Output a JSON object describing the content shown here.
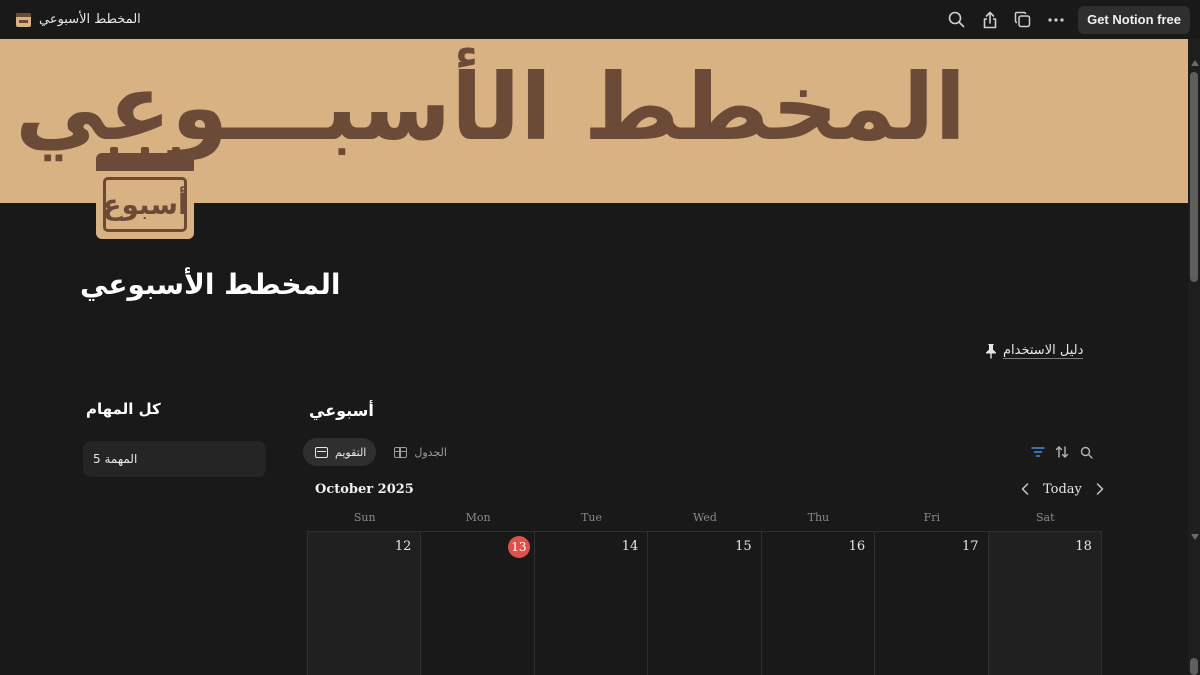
{
  "topbar": {
    "page_title": "المخطط الأسبوعي",
    "get_notion_label": "Get Notion free"
  },
  "cover": {
    "text": "المخطط الأسبـــوعي",
    "background": "#d8b283",
    "text_color": "#6b4a38"
  },
  "page_icon": {
    "text": "أسبوع"
  },
  "page": {
    "title": "المخطط الأسبوعي",
    "guide_link": "دليل الاستخدام"
  },
  "left": {
    "title": "كل المهام",
    "tasks": [
      "المهمة 5"
    ]
  },
  "calendar": {
    "title": "أسبوعي",
    "views": [
      {
        "label": "التقويم",
        "active": true
      },
      {
        "label": "الجدول",
        "active": false
      }
    ],
    "month": "October 2025",
    "today_label": "Today",
    "weekdays": [
      "Sun",
      "Mon",
      "Tue",
      "Wed",
      "Thu",
      "Fri",
      "Sat"
    ],
    "days": [
      {
        "num": "12",
        "today": false
      },
      {
        "num": "13",
        "today": true
      },
      {
        "num": "14",
        "today": false
      },
      {
        "num": "15",
        "today": false
      },
      {
        "num": "16",
        "today": false
      },
      {
        "num": "17",
        "today": false
      },
      {
        "num": "18",
        "today": false
      }
    ],
    "today_color": "#e0504a",
    "filter_color": "#4a8cd8"
  },
  "icons": [
    "search-icon",
    "share-icon",
    "duplicate-icon",
    "more-icon",
    "pin-icon",
    "filter-icon",
    "sort-icon",
    "calendar-icon",
    "table-icon",
    "chevron-left-icon",
    "chevron-right-icon"
  ]
}
